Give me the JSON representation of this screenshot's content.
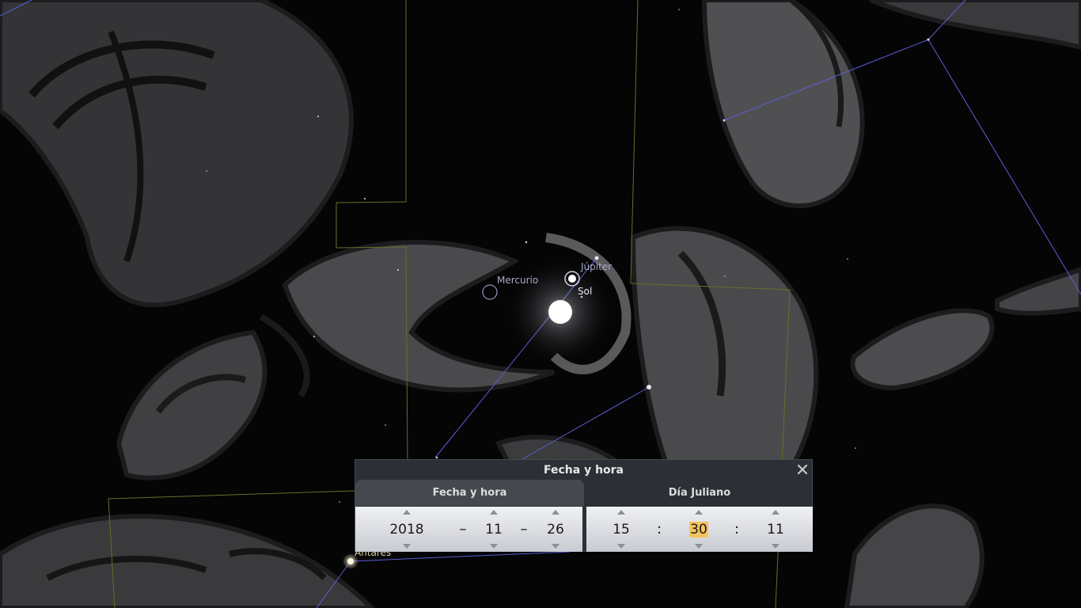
{
  "sky": {
    "labels": {
      "mercury": "Mercurio",
      "jupiter": "Júpiter",
      "sun": "Sol",
      "antares": "Antares"
    },
    "colors": {
      "constellation_line": "#5a5fd6",
      "boundary_line": "#6d6a2a",
      "planet_label": "#a9aac8",
      "star_label": "#d8cfa8"
    }
  },
  "dialog": {
    "title": "Fecha y hora",
    "close_icon": "close-icon",
    "tabs": {
      "date_time": "Fecha y hora",
      "julian_day": "Día Juliano"
    },
    "date": {
      "year": "2018",
      "month": "11",
      "day": "26",
      "separator": "–"
    },
    "time": {
      "hour": "15",
      "minute": "30",
      "second": "11",
      "separator": ":"
    },
    "colors": {
      "selection": "#f4c35c",
      "panel_bg": "#2c3036"
    }
  }
}
